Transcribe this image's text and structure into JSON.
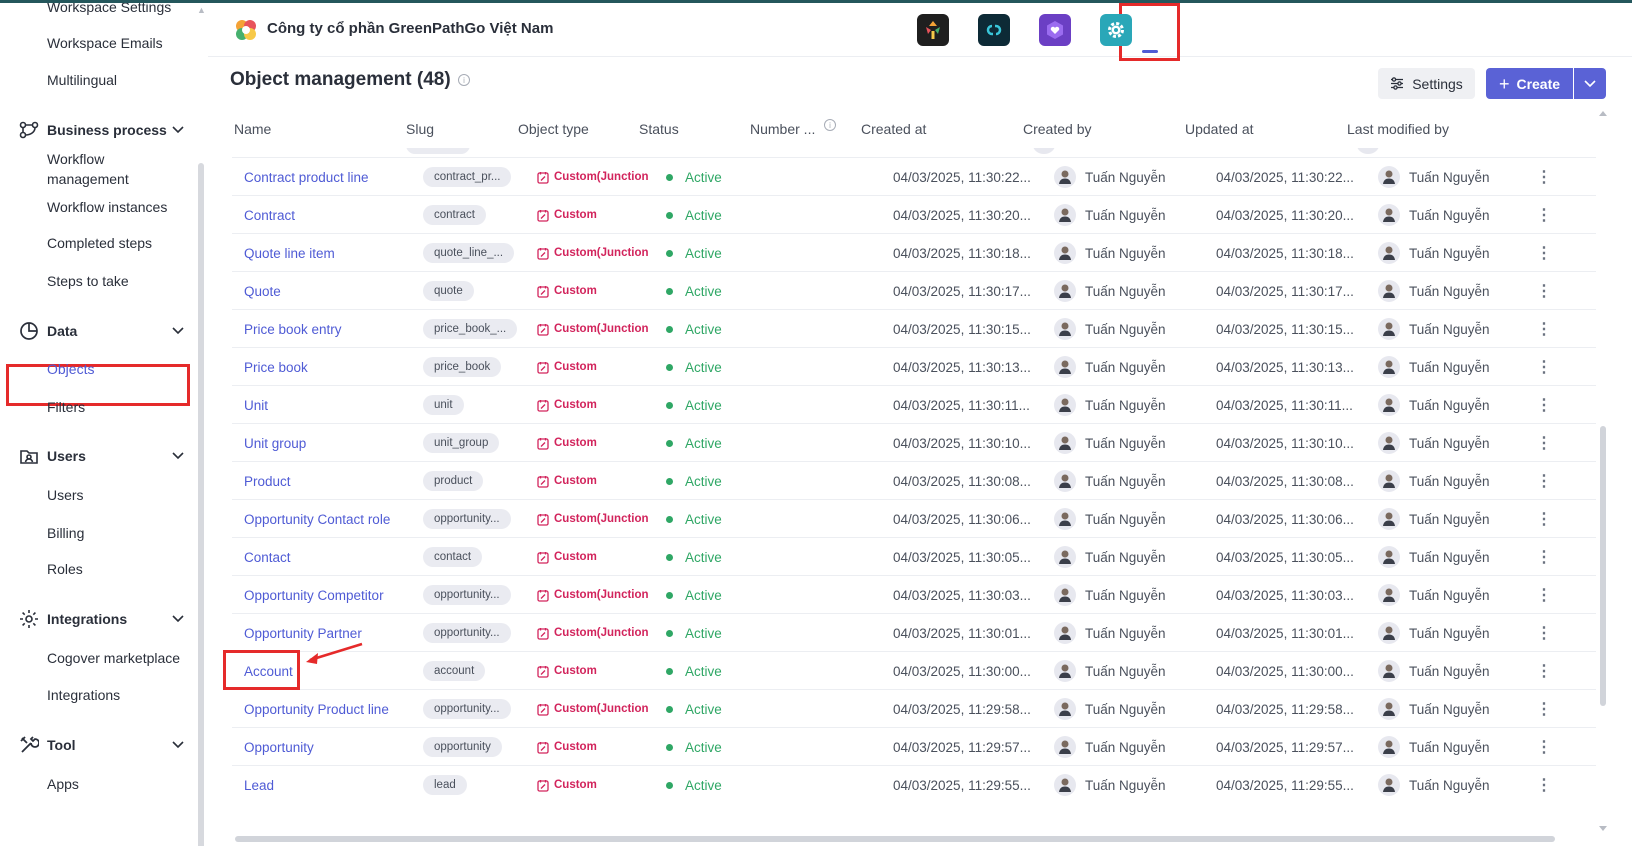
{
  "sidebar": {
    "items_top": [
      "Workspace Settings",
      "Workspace Emails",
      "Multilingual"
    ],
    "groups": [
      {
        "label": "Business process",
        "items": [
          "Workflow management",
          "Workflow instances",
          "Completed steps",
          "Steps to take"
        ]
      },
      {
        "label": "Data",
        "items": [
          "Objects",
          "Filters"
        ]
      },
      {
        "label": "Users",
        "items": [
          "Users",
          "Billing",
          "Roles"
        ]
      },
      {
        "label": "Integrations",
        "items": [
          "Cogover marketplace",
          "Integrations"
        ]
      },
      {
        "label": "Tool",
        "items": [
          "Apps"
        ]
      }
    ],
    "workflow_management_line1": "Workflow",
    "workflow_management_line2": "management",
    "active_item": "Objects"
  },
  "header": {
    "company_name": "Công ty cổ phần GreenPathGo Việt Nam",
    "apps": [
      "app-grid-icon",
      "link-icon",
      "heart-box-icon",
      "gear-icon"
    ],
    "active_app": "gear-icon"
  },
  "page": {
    "title": "Object management (48)",
    "settings_label": "Settings",
    "create_label": "Create"
  },
  "table": {
    "columns": [
      "Name",
      "Slug",
      "Object type",
      "Status",
      "Number ...",
      "Created at",
      "Created by",
      "Updated at",
      "Last modified by"
    ],
    "rows": [
      {
        "name": "Contract product line",
        "slug": "contract_pr...",
        "type": "Custom(Junction",
        "status": "Active",
        "created_at": "04/03/2025, 11:30:22...",
        "created_by": "Tuấn Nguyễn",
        "updated_at": "04/03/2025, 11:30:22...",
        "modified_by": "Tuấn Nguyễn"
      },
      {
        "name": "Contract",
        "slug": "contract",
        "type": "Custom",
        "status": "Active",
        "created_at": "04/03/2025, 11:30:20...",
        "created_by": "Tuấn Nguyễn",
        "updated_at": "04/03/2025, 11:30:20...",
        "modified_by": "Tuấn Nguyễn"
      },
      {
        "name": "Quote line item",
        "slug": "quote_line_...",
        "type": "Custom(Junction",
        "status": "Active",
        "created_at": "04/03/2025, 11:30:18...",
        "created_by": "Tuấn Nguyễn",
        "updated_at": "04/03/2025, 11:30:18...",
        "modified_by": "Tuấn Nguyễn"
      },
      {
        "name": "Quote",
        "slug": "quote",
        "type": "Custom",
        "status": "Active",
        "created_at": "04/03/2025, 11:30:17...",
        "created_by": "Tuấn Nguyễn",
        "updated_at": "04/03/2025, 11:30:17...",
        "modified_by": "Tuấn Nguyễn"
      },
      {
        "name": "Price book entry",
        "slug": "price_book_...",
        "type": "Custom(Junction",
        "status": "Active",
        "created_at": "04/03/2025, 11:30:15...",
        "created_by": "Tuấn Nguyễn",
        "updated_at": "04/03/2025, 11:30:15...",
        "modified_by": "Tuấn Nguyễn"
      },
      {
        "name": "Price book",
        "slug": "price_book",
        "type": "Custom",
        "status": "Active",
        "created_at": "04/03/2025, 11:30:13...",
        "created_by": "Tuấn Nguyễn",
        "updated_at": "04/03/2025, 11:30:13...",
        "modified_by": "Tuấn Nguyễn"
      },
      {
        "name": "Unit",
        "slug": "unit",
        "type": "Custom",
        "status": "Active",
        "created_at": "04/03/2025, 11:30:11...",
        "created_by": "Tuấn Nguyễn",
        "updated_at": "04/03/2025, 11:30:11...",
        "modified_by": "Tuấn Nguyễn"
      },
      {
        "name": "Unit group",
        "slug": "unit_group",
        "type": "Custom",
        "status": "Active",
        "created_at": "04/03/2025, 11:30:10...",
        "created_by": "Tuấn Nguyễn",
        "updated_at": "04/03/2025, 11:30:10...",
        "modified_by": "Tuấn Nguyễn"
      },
      {
        "name": "Product",
        "slug": "product",
        "type": "Custom",
        "status": "Active",
        "created_at": "04/03/2025, 11:30:08...",
        "created_by": "Tuấn Nguyễn",
        "updated_at": "04/03/2025, 11:30:08...",
        "modified_by": "Tuấn Nguyễn"
      },
      {
        "name": "Opportunity Contact role",
        "slug": "opportunity...",
        "type": "Custom(Junction",
        "status": "Active",
        "created_at": "04/03/2025, 11:30:06...",
        "created_by": "Tuấn Nguyễn",
        "updated_at": "04/03/2025, 11:30:06...",
        "modified_by": "Tuấn Nguyễn"
      },
      {
        "name": "Contact",
        "slug": "contact",
        "type": "Custom",
        "status": "Active",
        "created_at": "04/03/2025, 11:30:05...",
        "created_by": "Tuấn Nguyễn",
        "updated_at": "04/03/2025, 11:30:05...",
        "modified_by": "Tuấn Nguyễn"
      },
      {
        "name": "Opportunity Competitor",
        "slug": "opportunity...",
        "type": "Custom(Junction",
        "status": "Active",
        "created_at": "04/03/2025, 11:30:03...",
        "created_by": "Tuấn Nguyễn",
        "updated_at": "04/03/2025, 11:30:03...",
        "modified_by": "Tuấn Nguyễn"
      },
      {
        "name": "Opportunity Partner",
        "slug": "opportunity...",
        "type": "Custom(Junction",
        "status": "Active",
        "created_at": "04/03/2025, 11:30:01...",
        "created_by": "Tuấn Nguyễn",
        "updated_at": "04/03/2025, 11:30:01...",
        "modified_by": "Tuấn Nguyễn"
      },
      {
        "name": "Account",
        "slug": "account",
        "type": "Custom",
        "status": "Active",
        "created_at": "04/03/2025, 11:30:00...",
        "created_by": "Tuấn Nguyễn",
        "updated_at": "04/03/2025, 11:30:00...",
        "modified_by": "Tuấn Nguyễn"
      },
      {
        "name": "Opportunity Product line",
        "slug": "opportunity...",
        "type": "Custom(Junction",
        "status": "Active",
        "created_at": "04/03/2025, 11:29:58...",
        "created_by": "Tuấn Nguyễn",
        "updated_at": "04/03/2025, 11:29:58...",
        "modified_by": "Tuấn Nguyễn"
      },
      {
        "name": "Opportunity",
        "slug": "opportunity",
        "type": "Custom",
        "status": "Active",
        "created_at": "04/03/2025, 11:29:57...",
        "created_by": "Tuấn Nguyễn",
        "updated_at": "04/03/2025, 11:29:57...",
        "modified_by": "Tuấn Nguyễn"
      },
      {
        "name": "Lead",
        "slug": "lead",
        "type": "Custom",
        "status": "Active",
        "created_at": "04/03/2025, 11:29:55...",
        "created_by": "Tuấn Nguyễn",
        "updated_at": "04/03/2025, 11:29:55...",
        "modified_by": "Tuấn Nguyễn"
      }
    ]
  },
  "colors": {
    "accent": "#5a62d6",
    "link": "#4f5bd5",
    "custom_type": "#d2245c",
    "active_status": "#2fa765",
    "highlight": "#e52a2a"
  }
}
